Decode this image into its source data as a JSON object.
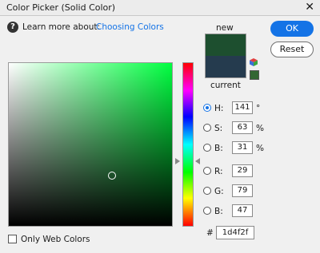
{
  "window": {
    "title": "Color Picker (Solid Color)",
    "close_glyph": "✕"
  },
  "help": {
    "icon": "question-icon",
    "glyph": "?",
    "label": "Learn more about:",
    "link": "Choosing Colors"
  },
  "buttons": {
    "ok": "OK",
    "reset": "Reset"
  },
  "preview": {
    "new_label": "new",
    "current_label": "current",
    "new_color": "#1d4f2f",
    "current_color": "#253b4e",
    "websafe_color": "#336633"
  },
  "picker": {
    "hue_color": "#00ff40",
    "marker_saturation": 0.63,
    "marker_brightness": 0.31,
    "hue_position": 0.6
  },
  "channels": {
    "h": {
      "label": "H:",
      "value": "141",
      "unit": "°",
      "selected": true
    },
    "s": {
      "label": "S:",
      "value": "63",
      "unit": "%"
    },
    "b": {
      "label": "B:",
      "value": "31",
      "unit": "%"
    },
    "r": {
      "label": "R:",
      "value": "29"
    },
    "g": {
      "label": "G:",
      "value": "79"
    },
    "bl": {
      "label": "B:",
      "value": "47"
    }
  },
  "hex": {
    "label": "#",
    "value": "1d4f2f"
  },
  "web_colors": {
    "label": "Only Web Colors",
    "checked": false
  },
  "colors": {
    "accent": "#1473e6"
  }
}
